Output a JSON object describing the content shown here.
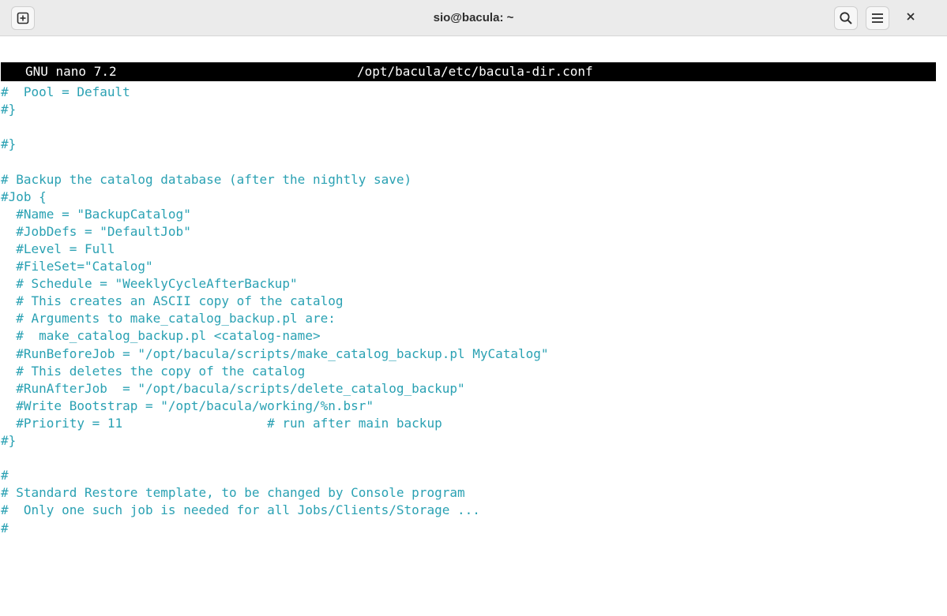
{
  "window": {
    "title": "sio@bacula: ~"
  },
  "titlebar": {
    "new_tab_icon": "plus-square-icon",
    "search_icon": "search-icon",
    "menu_icon": "hamburger-menu-icon",
    "close_icon": "close-icon"
  },
  "nano": {
    "version": "GNU nano 7.2",
    "filename": "/opt/bacula/etc/bacula-dir.conf"
  },
  "editor": {
    "lines": [
      "#  Pool = Default",
      "#}",
      "",
      "#}",
      "",
      "# Backup the catalog database (after the nightly save)",
      "#Job {",
      "  #Name = \"BackupCatalog\"",
      "  #JobDefs = \"DefaultJob\"",
      "  #Level = Full",
      "  #FileSet=\"Catalog\"",
      "  # Schedule = \"WeeklyCycleAfterBackup\"",
      "  # This creates an ASCII copy of the catalog",
      "  # Arguments to make_catalog_backup.pl are:",
      "  #  make_catalog_backup.pl <catalog-name>",
      "  #RunBeforeJob = \"/opt/bacula/scripts/make_catalog_backup.pl MyCatalog\"",
      "  # This deletes the copy of the catalog",
      "  #RunAfterJob  = \"/opt/bacula/scripts/delete_catalog_backup\"",
      "  #Write Bootstrap = \"/opt/bacula/working/%n.bsr\"",
      "  #Priority = 11                   # run after main backup",
      "#}",
      "",
      "#",
      "# Standard Restore template, to be changed by Console program",
      "#  Only one such job is needed for all Jobs/Clients/Storage ...",
      "#"
    ]
  },
  "colors": {
    "text": "#2aa1b3",
    "header_bg": "#000000",
    "header_fg": "#ffffff",
    "titlebar_bg": "#ebebeb"
  }
}
